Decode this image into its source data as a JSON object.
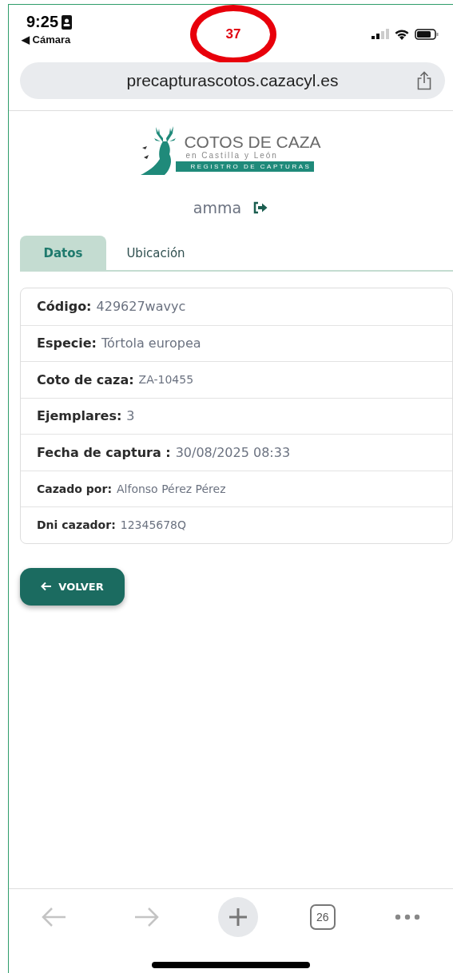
{
  "status_bar": {
    "time": "9:25",
    "back_app": "◀ Cámara"
  },
  "annotation": {
    "label": "37"
  },
  "address_bar": {
    "url": "precapturascotos.cazacyl.es"
  },
  "logo": {
    "title": "COTOS DE CAZA",
    "subtitle": "en Castilla y León",
    "banner": "REGISTRO DE CAPTURAS"
  },
  "user": {
    "name": "amma"
  },
  "tabs": [
    {
      "label": "Datos",
      "selected": true
    },
    {
      "label": "Ubicación",
      "selected": false
    }
  ],
  "details": [
    {
      "label": "Código:",
      "value": "429627wavyc",
      "kind": "large"
    },
    {
      "label": "Especie:",
      "value": "Tórtola europea",
      "kind": "large"
    },
    {
      "label": "Coto de caza:",
      "value": "ZA-10455",
      "kind": "mixed"
    },
    {
      "label": "Ejemplares:",
      "value": "3",
      "kind": "large"
    },
    {
      "label": "Fecha de captura :",
      "value": "30/08/2025 08:33",
      "kind": "large"
    },
    {
      "label": "Cazado por:",
      "value": "Alfonso Pérez Pérez",
      "kind": "small"
    },
    {
      "label": "Dni cazador:",
      "value": "12345678Q",
      "kind": "small"
    }
  ],
  "back_button": {
    "label": "VOLVER"
  },
  "toolbar": {
    "tab_count": "26"
  }
}
